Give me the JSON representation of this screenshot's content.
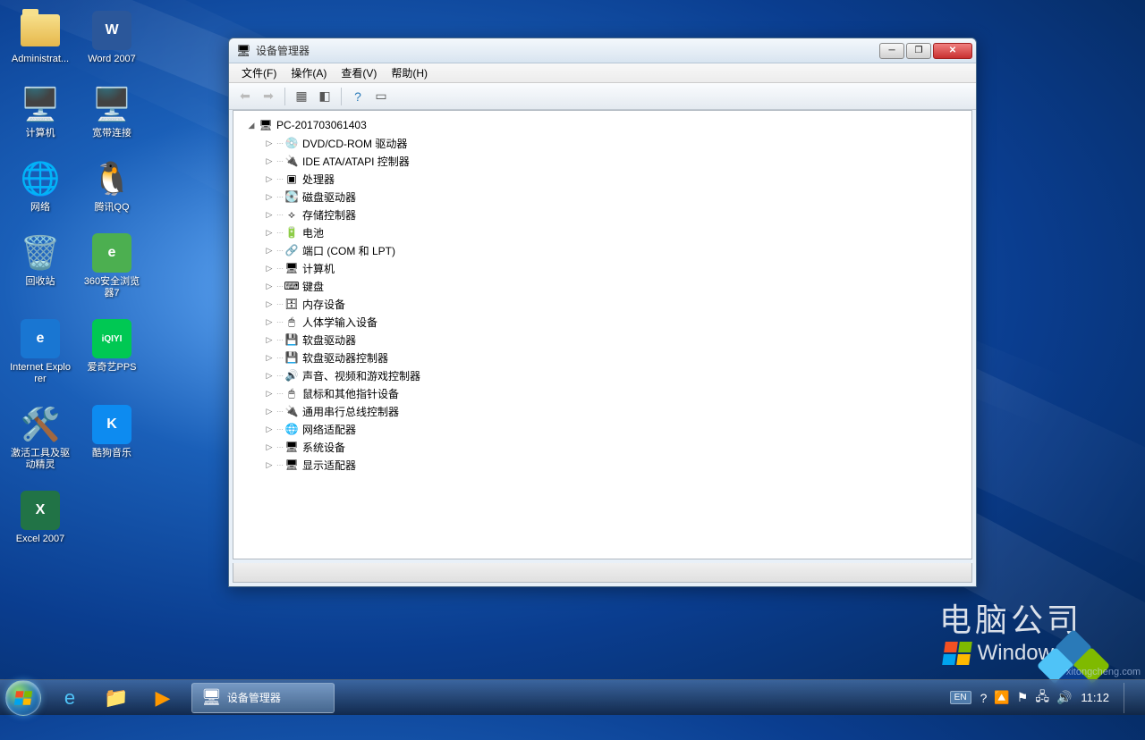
{
  "desktop": {
    "icons": [
      [
        {
          "name": "administrator-icon",
          "label": "Administrat...",
          "glyph": "📁",
          "style": "folder"
        },
        {
          "name": "word-2007-icon",
          "label": "Word 2007",
          "glyph": "W",
          "bg": "#2b579a"
        }
      ],
      [
        {
          "name": "computer-icon",
          "label": "计算机",
          "glyph": "🖥️"
        },
        {
          "name": "broadband-icon",
          "label": "宽带连接",
          "glyph": "🖥️"
        }
      ],
      [
        {
          "name": "network-icon",
          "label": "网络",
          "glyph": "🌐"
        },
        {
          "name": "qq-icon",
          "label": "腾讯QQ",
          "glyph": "🐧"
        }
      ],
      [
        {
          "name": "recycle-bin-icon",
          "label": "回收站",
          "glyph": "🗑️"
        },
        {
          "name": "360-browser-icon",
          "label": "360安全浏览器7",
          "glyph": "e",
          "bg": "#4caf50"
        }
      ],
      [
        {
          "name": "ie-icon",
          "label": "Internet Explorer",
          "glyph": "e",
          "bg": "#1976d2"
        },
        {
          "name": "iqiyi-icon",
          "label": "爱奇艺PPS",
          "glyph": "iQIYI",
          "bg": "#00c853",
          "fs": "10px"
        }
      ],
      [
        {
          "name": "activation-icon",
          "label": "激活工具及驱动精灵",
          "glyph": "🛠️"
        },
        {
          "name": "kugou-icon",
          "label": "酷狗音乐",
          "glyph": "K",
          "bg": "#0d8bf0"
        }
      ],
      [
        {
          "name": "excel-2007-icon",
          "label": "Excel 2007",
          "glyph": "X",
          "bg": "#217346"
        }
      ]
    ]
  },
  "branding": {
    "company": "电脑公司",
    "os": "Windows 7",
    "watermark": "xitongcheng.com"
  },
  "window": {
    "title": "设备管理器",
    "menus": [
      "文件(F)",
      "操作(A)",
      "查看(V)",
      "帮助(H)"
    ],
    "toolbar": [
      {
        "name": "back-button",
        "glyph": "⬅",
        "disabled": true
      },
      {
        "name": "forward-button",
        "glyph": "➡",
        "disabled": true
      },
      {
        "sep": true
      },
      {
        "name": "show-hidden-button",
        "glyph": "▦"
      },
      {
        "name": "properties-button",
        "glyph": "◧"
      },
      {
        "sep": true
      },
      {
        "name": "help-button",
        "glyph": "?",
        "color": "#2a7ab8"
      },
      {
        "name": "refresh-button",
        "glyph": "▭"
      }
    ],
    "tree": {
      "root": "PC-201703061403",
      "children": [
        {
          "icon": "💿",
          "label": "DVD/CD-ROM 驱动器"
        },
        {
          "icon": "🔌",
          "label": "IDE ATA/ATAPI 控制器"
        },
        {
          "icon": "▣",
          "label": "处理器"
        },
        {
          "icon": "💽",
          "label": "磁盘驱动器"
        },
        {
          "icon": "⟡",
          "label": "存储控制器"
        },
        {
          "icon": "🔋",
          "label": "电池"
        },
        {
          "icon": "🔗",
          "label": "端口 (COM 和 LPT)"
        },
        {
          "icon": "🖥",
          "label": "计算机"
        },
        {
          "icon": "⌨",
          "label": "键盘"
        },
        {
          "icon": "🗄",
          "label": "内存设备"
        },
        {
          "icon": "🖱",
          "label": "人体学输入设备"
        },
        {
          "icon": "💾",
          "label": "软盘驱动器"
        },
        {
          "icon": "💾",
          "label": "软盘驱动器控制器"
        },
        {
          "icon": "🔊",
          "label": "声音、视频和游戏控制器"
        },
        {
          "icon": "🖱",
          "label": "鼠标和其他指针设备"
        },
        {
          "icon": "🔌",
          "label": "通用串行总线控制器"
        },
        {
          "icon": "🌐",
          "label": "网络适配器"
        },
        {
          "icon": "🖥",
          "label": "系统设备"
        },
        {
          "icon": "🖥",
          "label": "显示适配器"
        }
      ]
    }
  },
  "taskbar": {
    "pinned": [
      {
        "name": "ie-pinned",
        "glyph": "e",
        "color": "#4fc3f7"
      },
      {
        "name": "explorer-pinned",
        "glyph": "📁",
        "color": "#ffd54f"
      },
      {
        "name": "media-player-pinned",
        "glyph": "▶",
        "color": "#ff9800"
      }
    ],
    "task": {
      "label": "设备管理器",
      "glyph": "🖥"
    },
    "tray": {
      "lang": "EN",
      "icons": [
        {
          "name": "help-tray-icon",
          "glyph": "?"
        },
        {
          "name": "top-tray-icon",
          "glyph": "🔼"
        },
        {
          "name": "flag-tray-icon",
          "glyph": "⚑"
        },
        {
          "name": "network-tray-icon",
          "glyph": "🖧"
        },
        {
          "name": "volume-tray-icon",
          "glyph": "🔊"
        }
      ],
      "clock": "11:12"
    }
  }
}
